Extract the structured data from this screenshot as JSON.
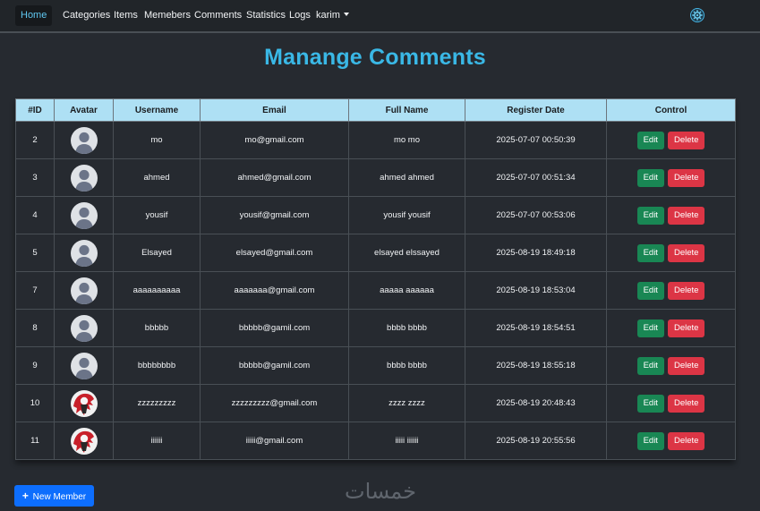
{
  "nav": {
    "home": "Home",
    "categories": "Categories",
    "items": "Items",
    "members": "Memebers",
    "comments": "Comments",
    "statistics": "Statistics",
    "logs": "Logs",
    "user": "karim"
  },
  "page": {
    "title": "Manange Comments"
  },
  "table": {
    "headers": [
      "#ID",
      "Avatar",
      "Username",
      "Email",
      "Full Name",
      "Register Date",
      "Control"
    ],
    "edit_label": "Edit",
    "delete_label": "Delete",
    "rows": [
      {
        "id": "2",
        "avatar": "default",
        "username": "mo",
        "email": "mo@gmail.com",
        "fullname": "mo mo",
        "date": "2025-07-07 00:50:39"
      },
      {
        "id": "3",
        "avatar": "default",
        "username": "ahmed",
        "email": "ahmed@gmail.com",
        "fullname": "ahmed ahmed",
        "date": "2025-07-07 00:51:34"
      },
      {
        "id": "4",
        "avatar": "default",
        "username": "yousif",
        "email": "yousif@gmail.com",
        "fullname": "yousif yousif",
        "date": "2025-07-07 00:53:06"
      },
      {
        "id": "5",
        "avatar": "default",
        "username": "Elsayed",
        "email": "elsayed@gmail.com",
        "fullname": "elsayed elssayed",
        "date": "2025-08-19 18:49:18"
      },
      {
        "id": "7",
        "avatar": "default",
        "username": "aaaaaaaaaa",
        "email": "aaaaaaa@gmail.com",
        "fullname": "aaaaa aaaaaa",
        "date": "2025-08-19 18:53:04"
      },
      {
        "id": "8",
        "avatar": "default",
        "username": "bbbbb",
        "email": "bbbbb@gamil.com",
        "fullname": "bbbb bbbb",
        "date": "2025-08-19 18:54:51"
      },
      {
        "id": "9",
        "avatar": "default",
        "username": "bbbbbbbb",
        "email": "bbbbb@gamil.com",
        "fullname": "bbbb bbbb",
        "date": "2025-08-19 18:55:18"
      },
      {
        "id": "10",
        "avatar": "custom",
        "username": "zzzzzzzzz",
        "email": "zzzzzzzzz@gmail.com",
        "fullname": "zzzz zzzz",
        "date": "2025-08-19 20:48:43"
      },
      {
        "id": "11",
        "avatar": "custom",
        "username": "iiiiii",
        "email": "iiiii@gmail.com",
        "fullname": "iiiii iiiiii",
        "date": "2025-08-19 20:55:56"
      }
    ]
  },
  "footer": {
    "new_member_label": "New Member",
    "watermark": "خمسات"
  },
  "colors": {
    "accent": "#3ab8e6",
    "header_bg": "#aee0f4",
    "edit": "#198754",
    "delete": "#dc3545",
    "primary": "#0d6efd"
  }
}
